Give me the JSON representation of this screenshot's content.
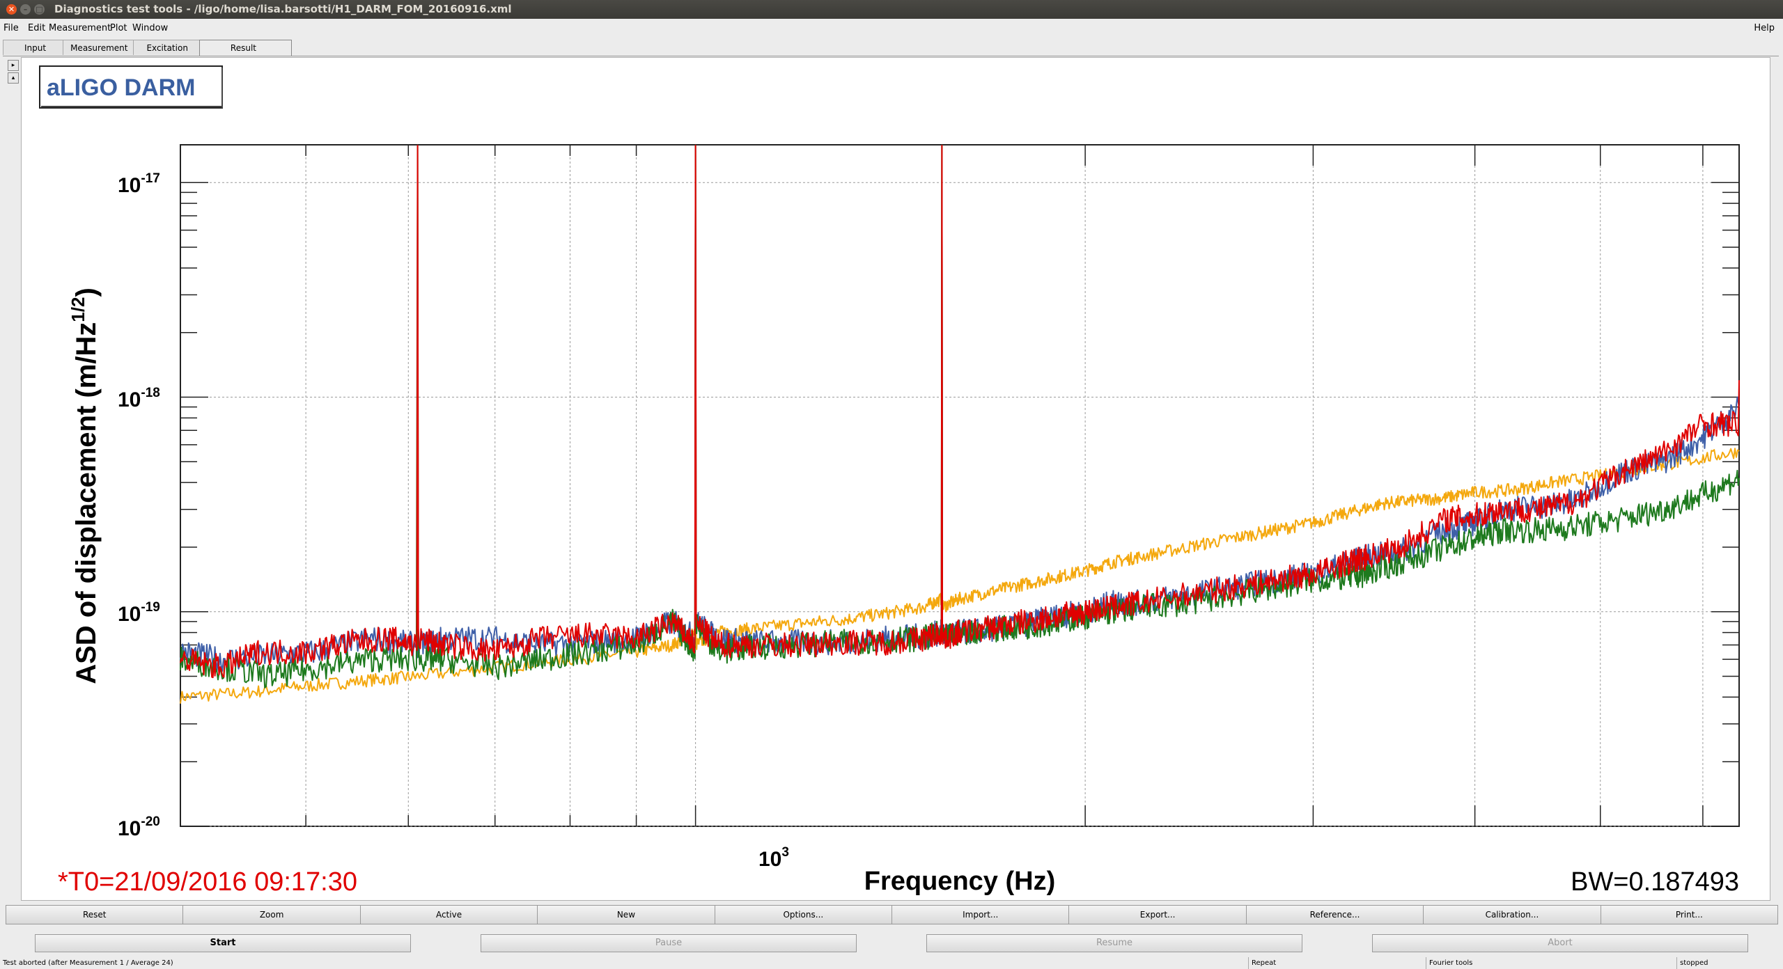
{
  "window": {
    "title": "Diagnostics test tools - /ligo/home/lisa.barsotti/H1_DARM_FOM_20160916.xml"
  },
  "menubar": {
    "items": [
      "File",
      "Edit",
      "Measurement",
      "Plot",
      "Window"
    ],
    "help": "Help"
  },
  "tabs": [
    "Input",
    "Measurement",
    "Excitation",
    "Result"
  ],
  "active_tab": "Result",
  "plot": {
    "legend_title": "aLIGO DARM",
    "ylabel": "ASD of displacement (m/Hz",
    "ylabel_sup": "1/2",
    "ylabel_tail": ")",
    "xlabel": "Frequency (Hz)",
    "t0": "*T0=21/09/2016 09:17:30",
    "bw": "BW=0.187493",
    "xtick_base": "10",
    "xtick_exp": "3",
    "ytick_base": "10",
    "ytick_exps": [
      "-17",
      "-18",
      "-19",
      "-20"
    ]
  },
  "chart_data": {
    "type": "line",
    "xlabel": "Frequency (Hz)",
    "ylabel": "ASD of displacement (m/Hz^1/2)",
    "x_scale": "log",
    "y_scale": "log",
    "xlim": [
      400,
      6400
    ],
    "ylim": [
      1e-20,
      1.5e-17
    ],
    "grid": true,
    "series_colors": [
      "#3e5fa8",
      "#1e7a1e",
      "#f4a80e",
      "#e00000"
    ],
    "series": [
      {
        "x": [
          400,
          430,
          470,
          510,
          560,
          610,
          640,
          700,
          760,
          830,
          900,
          960,
          1000,
          1040,
          1100,
          1200,
          1300,
          1400,
          1500,
          1550,
          1600,
          1700,
          1800,
          1900,
          2000,
          2100,
          2200,
          2400,
          2600,
          2800,
          3000,
          3200,
          3300,
          3500,
          3800,
          4000,
          4200,
          4500,
          4800,
          5200,
          5600,
          6000,
          6400
        ],
        "y": [
          6.5e-20,
          6e-20,
          6.2e-20,
          6.5e-20,
          7.5e-20,
          7e-20,
          7.5e-20,
          7.5e-20,
          7e-20,
          7.2e-20,
          7.5e-20,
          9e-20,
          1.5e-17,
          7.5e-20,
          7.2e-20,
          7.2e-20,
          7.2e-20,
          7.5e-20,
          7.7e-20,
          1.5e-17,
          8e-20,
          8.3e-20,
          8.8e-20,
          9.5e-20,
          1e-19,
          1.1e-19,
          1.1e-19,
          1.2e-19,
          1.3e-19,
          1.4e-19,
          1.5e-19,
          1.7e-19,
          1.8e-19,
          1.9e-19,
          2.4e-19,
          2.6e-19,
          3e-19,
          3.1e-19,
          3.3e-19,
          4.5e-19,
          5e-19,
          6.5e-19,
          9e-19
        ]
      },
      {
        "x": [
          400,
          430,
          470,
          510,
          560,
          610,
          640,
          700,
          760,
          830,
          900,
          960,
          1000,
          1040,
          1100,
          1200,
          1300,
          1400,
          1500,
          1550,
          1600,
          1700,
          1800,
          1900,
          2000,
          2100,
          2200,
          2400,
          2600,
          2800,
          3000,
          3200,
          3300,
          3500,
          3800,
          4000,
          4200,
          4500,
          4800,
          5200,
          5600,
          6000,
          6400
        ],
        "y": [
          6e-20,
          5.5e-20,
          5e-20,
          5.5e-20,
          6e-20,
          1.5e-17,
          6e-20,
          5.5e-20,
          6e-20,
          6.5e-20,
          7e-20,
          9e-20,
          1.5e-17,
          6.5e-20,
          6.8e-20,
          7e-20,
          7.2e-20,
          7.4e-20,
          7.5e-20,
          1.5e-17,
          8e-20,
          8.3e-20,
          8.5e-20,
          9e-20,
          9.5e-20,
          1e-19,
          1.05e-19,
          1.1e-19,
          1.2e-19,
          1.3e-19,
          1.4e-19,
          1.45e-19,
          1.5e-19,
          1.7e-19,
          2e-19,
          2.2e-19,
          2.4e-19,
          2.4e-19,
          2.5e-19,
          2.7e-19,
          3e-19,
          3.5e-19,
          4.2e-19
        ]
      },
      {
        "x": [
          400,
          450,
          500,
          560,
          610,
          700,
          800,
          900,
          960,
          1000,
          1040,
          1100,
          1200,
          1300,
          1400,
          1500,
          1550,
          1600,
          1700,
          1800,
          1900,
          2000,
          2100,
          2200,
          2400,
          2600,
          2800,
          3000,
          3200,
          3400,
          3600,
          3800,
          4000,
          4300,
          4600,
          5000,
          5400,
          5800,
          6400
        ],
        "y": [
          4e-20,
          4.2e-20,
          4.5e-20,
          4.8e-20,
          5e-20,
          5.5e-20,
          6e-20,
          6.5e-20,
          7e-20,
          1.5e-17,
          8e-20,
          8.3e-20,
          8.8e-20,
          9.2e-20,
          9.8e-20,
          1.05e-19,
          1.5e-17,
          1.15e-19,
          1.25e-19,
          1.35e-19,
          1.45e-19,
          1.55e-19,
          1.7e-19,
          1.8e-19,
          2e-19,
          2.2e-19,
          2.4e-19,
          2.6e-19,
          2.9e-19,
          3.2e-19,
          3.3e-19,
          3.4e-19,
          3.6e-19,
          3.7e-19,
          4e-19,
          4.3e-19,
          4.7e-19,
          5e-19,
          5.6e-19
        ]
      },
      {
        "x": [
          400,
          430,
          460,
          500,
          540,
          580,
          610,
          640,
          700,
          760,
          830,
          900,
          960,
          1000,
          1040,
          1100,
          1200,
          1300,
          1400,
          1500,
          1550,
          1600,
          1700,
          1800,
          1900,
          2000,
          2100,
          2200,
          2400,
          2600,
          2800,
          3000,
          3200,
          3300,
          3500,
          3800,
          4000,
          4200,
          4500,
          4800,
          5200,
          5600,
          6000,
          6400
        ],
        "y": [
          6e-20,
          5.5e-20,
          6.5e-20,
          6.5e-20,
          7.2e-20,
          7.5e-20,
          1.5e-17,
          7e-20,
          6.5e-20,
          7.5e-20,
          7.8e-20,
          7.5e-20,
          9e-20,
          1.5e-17,
          7e-20,
          7e-20,
          7e-20,
          7.2e-20,
          7.2e-20,
          7.5e-20,
          1.5e-17,
          8e-20,
          8.5e-20,
          9e-20,
          9.5e-20,
          1e-19,
          1.05e-19,
          1.1e-19,
          1.2e-19,
          1.3e-19,
          1.4e-19,
          1.5e-19,
          1.7e-19,
          1.8e-19,
          2e-19,
          2.7e-19,
          2.8e-19,
          3e-19,
          3e-19,
          3.3e-19,
          4.5e-19,
          5.5e-19,
          7.5e-19,
          1.2e-18
        ]
      }
    ]
  },
  "buttons_row1": [
    "Reset",
    "Zoom",
    "Active",
    "New",
    "Options...",
    "Import...",
    "Export...",
    "Reference...",
    "Calibration...",
    "Print..."
  ],
  "buttons_row2": [
    "Start",
    "Pause",
    "Resume",
    "Abort"
  ],
  "status": {
    "message": "Test aborted (after Measurement 1 / Average 24)",
    "repeat": "Repeat",
    "tools": "Fourier tools",
    "state": "stopped"
  }
}
